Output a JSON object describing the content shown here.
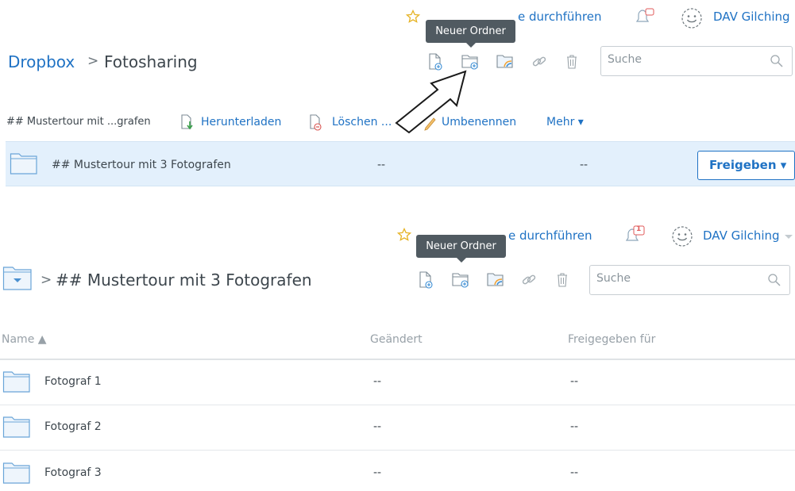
{
  "colors": {
    "link": "#1f72c4",
    "selected_row": "#e3f0fc",
    "tooltip": "#505a61",
    "folder_stroke": "#6aa5d8",
    "folder_fill": "#eef5fc"
  },
  "top": {
    "tour_link": "e durchführen",
    "user_name": "DAV Gilching",
    "tooltip": "Neuer Ordner",
    "breadcrumb_root": "Dropbox",
    "breadcrumb_sep": ">",
    "breadcrumb_current": "Fotosharing",
    "search_placeholder": "Suche",
    "actions": {
      "selected_name": "## Mustertour mit ...grafen",
      "download": "Herunterladen",
      "delete": "Löschen ...",
      "rename": "Umbenennen",
      "more": "Mehr ▾"
    },
    "row": {
      "name": "## Mustertour mit 3 Fotografen",
      "modified": "--",
      "shared": "--",
      "share_button": "Freigeben ▾"
    }
  },
  "bottom": {
    "tour_link": "e durchführen",
    "notification_count": "1",
    "user_name": "DAV Gilching",
    "tooltip": "Neuer Ordner",
    "breadcrumb_sep": ">",
    "breadcrumb_current": "## Mustertour mit 3 Fotografen",
    "search_placeholder": "Suche",
    "columns": {
      "name": "Name ▲",
      "modified": "Geändert",
      "shared": "Freigegeben für"
    },
    "rows": [
      {
        "name": "Fotograf 1",
        "modified": "--",
        "shared": "--"
      },
      {
        "name": "Fotograf 2",
        "modified": "--",
        "shared": "--"
      },
      {
        "name": "Fotograf 3",
        "modified": "--",
        "shared": "--"
      }
    ]
  }
}
